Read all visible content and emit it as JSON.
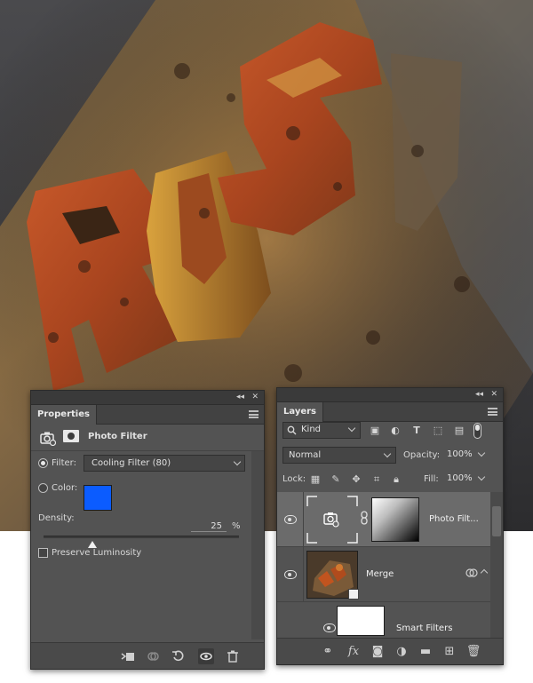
{
  "artwork": {
    "text": "RUST"
  },
  "properties": {
    "tab_label": "Properties",
    "adjustment_title": "Photo Filter",
    "filter_label": "Filter:",
    "filter_value": "Cooling Filter (80)",
    "color_label": "Color:",
    "color_value": "#0b5cff",
    "density_label": "Density:",
    "density_value": "25",
    "density_unit": "%",
    "density_fraction": 0.25,
    "preserve_label": "Preserve Luminosity",
    "preserve_checked": false,
    "filter_selected": true
  },
  "layers": {
    "tab_label": "Layers",
    "kind_label": "Kind",
    "blend_mode": "Normal",
    "opacity_label": "Opacity:",
    "opacity_value": "100%",
    "lock_label": "Lock:",
    "fill_label": "Fill:",
    "fill_value": "100%",
    "items": [
      {
        "name": "Photo Filt...",
        "selected": true
      },
      {
        "name": "Merge",
        "selected": false
      },
      {
        "name": "Smart Filters",
        "selected": false
      }
    ]
  },
  "icons": {
    "panel_controls": [
      "collapse-icon",
      "close-icon"
    ],
    "panel_menu": "panel-menu-icon"
  }
}
